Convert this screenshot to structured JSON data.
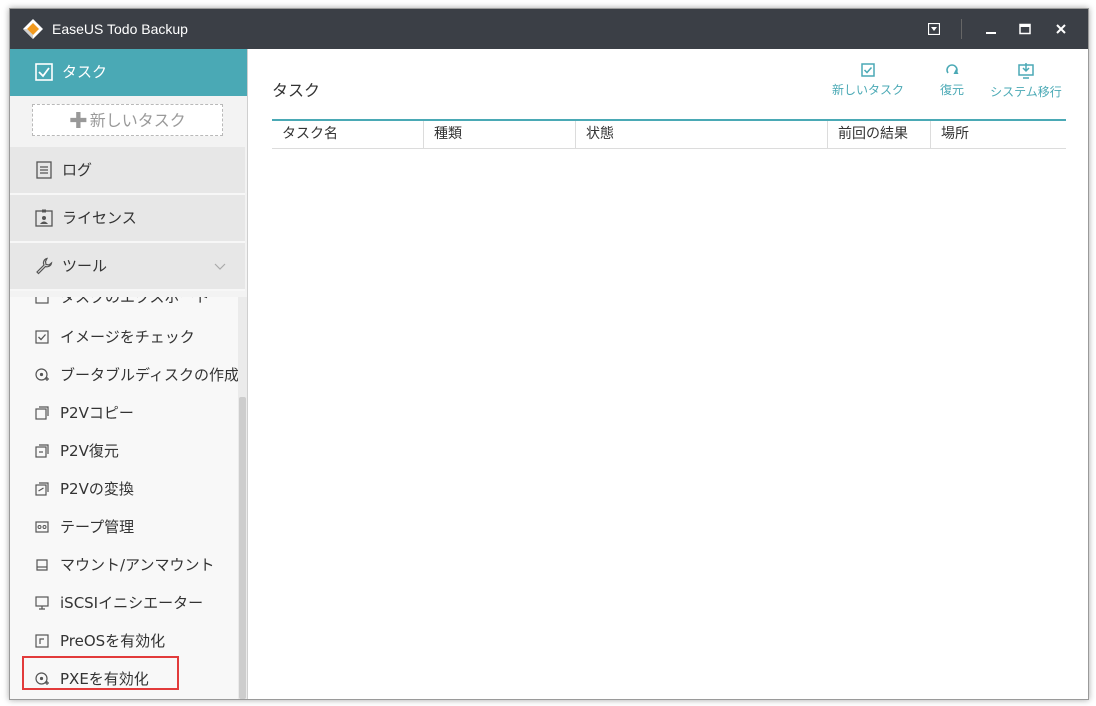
{
  "window": {
    "title": "EaseUS Todo Backup"
  },
  "sidebar": {
    "task_label": "タスク",
    "new_task_label": "新しいタスク",
    "log_label": "ログ",
    "license_label": "ライセンス",
    "tools_label": "ツール",
    "tools": [
      {
        "label": "タスクのエクスポート"
      },
      {
        "label": "イメージをチェック"
      },
      {
        "label": "ブータブルディスクの作成"
      },
      {
        "label": "P2Vコピー"
      },
      {
        "label": "P2V復元"
      },
      {
        "label": "P2Vの変換"
      },
      {
        "label": "テープ管理"
      },
      {
        "label": "マウント/アンマウント"
      },
      {
        "label": "iSCSIイニシエーター"
      },
      {
        "label": "PreOSを有効化"
      },
      {
        "label": "PXEを有効化"
      }
    ]
  },
  "main": {
    "title": "タスク",
    "actions": {
      "new_task": "新しいタスク",
      "restore": "復元",
      "migrate": "システム移行"
    },
    "columns": [
      "タスク名",
      "種類",
      "状態",
      "前回の結果",
      "場所"
    ]
  },
  "colors": {
    "accent": "#4aa9b5",
    "titlebar": "#3b3f46",
    "highlight": "#e23b3b"
  }
}
